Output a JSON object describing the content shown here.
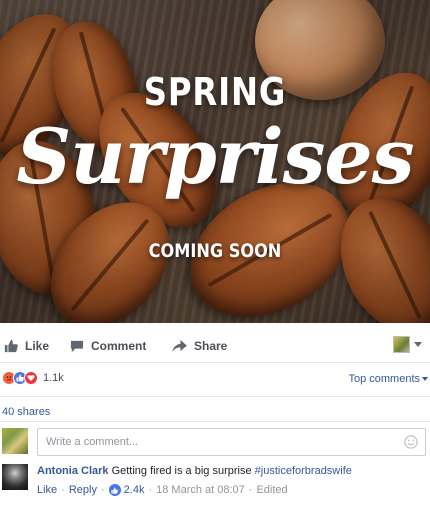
{
  "hero": {
    "line1": "SPRING",
    "line2": "Surprises",
    "line3": "COMING SOON"
  },
  "actions": {
    "like": "Like",
    "comment": "Comment",
    "share": "Share"
  },
  "reactions": {
    "count": "1.1k",
    "top_comments": "Top comments"
  },
  "shares": "40 shares",
  "comment_input": {
    "placeholder": "Write a comment..."
  },
  "comment": {
    "author": "Antonia Clark",
    "text": "Getting fired is a big surprise",
    "hashtag": "#justiceforbradswife",
    "like_label": "Like",
    "reply_label": "Reply",
    "likes": "2.4k",
    "timestamp": "18 March at 08:07",
    "edited": "Edited"
  },
  "icons": {
    "like": "thumbs-up-icon",
    "comment": "speech-bubble-icon",
    "share": "share-arrow-icon",
    "emoji": "smiley-icon"
  },
  "colors": {
    "link": "#365899",
    "like_blue": "#4a76e8",
    "love_red": "#f0323c",
    "angry_orange": "#f0603a",
    "muted": "#90949c"
  }
}
